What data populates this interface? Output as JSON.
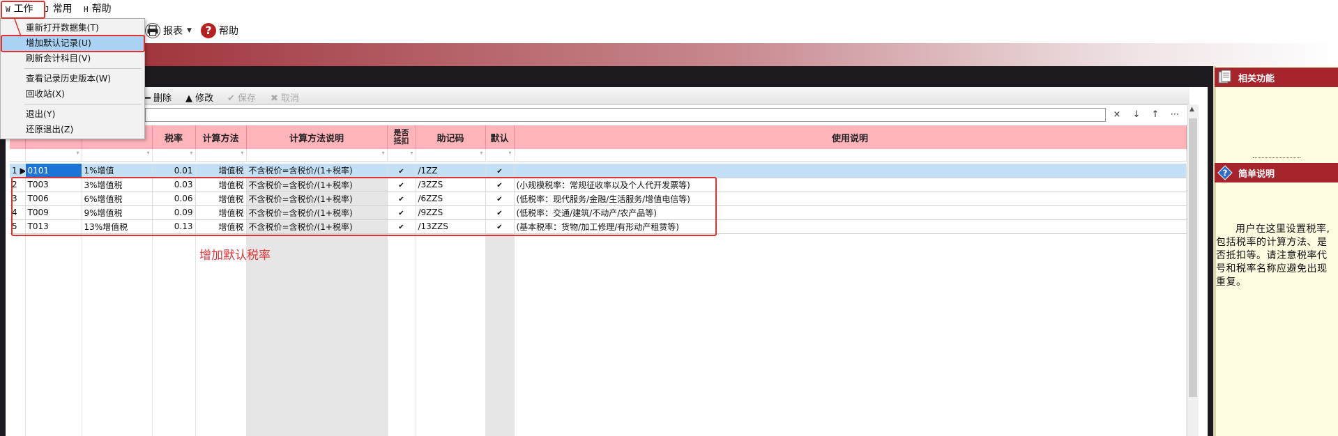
{
  "menubar": {
    "items": [
      {
        "accel": "W",
        "label": "工作"
      },
      {
        "accel": "J",
        "label": "常用"
      },
      {
        "accel": "H",
        "label": "帮助"
      }
    ]
  },
  "toolbar": {
    "report_label": "报表",
    "help_label": "帮助"
  },
  "dropdown": {
    "items": [
      "重新打开数据集(T)",
      "增加默认记录(U)",
      "刷新会计科目(V)",
      "查看记录历史版本(W)",
      "回收站(X)",
      "退出(Y)",
      "还原退出(Z)"
    ],
    "highlighted_index": 1
  },
  "gridbar": {
    "delete_label": "删除",
    "edit_label": "修改",
    "save_label": "保存",
    "cancel_label": "取消"
  },
  "filter_tools": [
    "×",
    "↓",
    "↑",
    "⋯"
  ],
  "grid": {
    "columns": [
      "",
      "",
      "税率",
      "计算方法",
      "计算方法说明",
      "是否抵扣",
      "助记码",
      "默认",
      "使用说明"
    ],
    "rows": [
      {
        "num": "1",
        "code": "0101",
        "name": "1%增值",
        "rate": "0.01",
        "method": "增值税",
        "desc": "不含税价=含税价/(1+税率)",
        "deduct": "✔",
        "mnemonic": "/1ZZ",
        "default": "✔",
        "usage": ""
      },
      {
        "num": "2",
        "code": "T003",
        "name": "3%增值税",
        "rate": "0.03",
        "method": "增值税",
        "desc": "不含税价=含税价/(1+税率)",
        "deduct": "✔",
        "mnemonic": "/3ZZS",
        "default": "✔",
        "usage": "(小规模税率：常规征收率以及个人代开发票等)"
      },
      {
        "num": "3",
        "code": "T006",
        "name": "6%增值税",
        "rate": "0.06",
        "method": "增值税",
        "desc": "不含税价=含税价/(1+税率)",
        "deduct": "✔",
        "mnemonic": "/6ZZS",
        "default": "✔",
        "usage": "(低税率：现代服务/金融/生活服务/增值电信等)"
      },
      {
        "num": "4",
        "code": "T009",
        "name": "9%增值税",
        "rate": "0.09",
        "method": "增值税",
        "desc": "不含税价=含税价/(1+税率)",
        "deduct": "✔",
        "mnemonic": "/9ZZS",
        "default": "✔",
        "usage": "(低税率：交通/建筑/不动产/农产品等)"
      },
      {
        "num": "5",
        "code": "T013",
        "name": "13%增值税",
        "rate": "0.13",
        "method": "增值税",
        "desc": "不含税价=含税价/(1+税率)",
        "deduct": "✔",
        "mnemonic": "/13ZZS",
        "default": "✔",
        "usage": "(基本税率：货物/加工修理/有形动产租赁等)"
      }
    ]
  },
  "annotation": {
    "text": "增加默认税率"
  },
  "right_panel": {
    "related_title": "相关功能",
    "brief_title": "简单说明",
    "brief_text": "用户在这里设置税率,包括税率的计算方法、是否抵扣等。请注意税率代号和税率名称应避免出现重复。"
  },
  "colors": {
    "header_pink": "#ffb3bb",
    "panel_red": "#a8242c",
    "annotation_red": "#e03030",
    "selected_row": "#c3e0f6",
    "right_panel_bg": "#fffde2"
  }
}
